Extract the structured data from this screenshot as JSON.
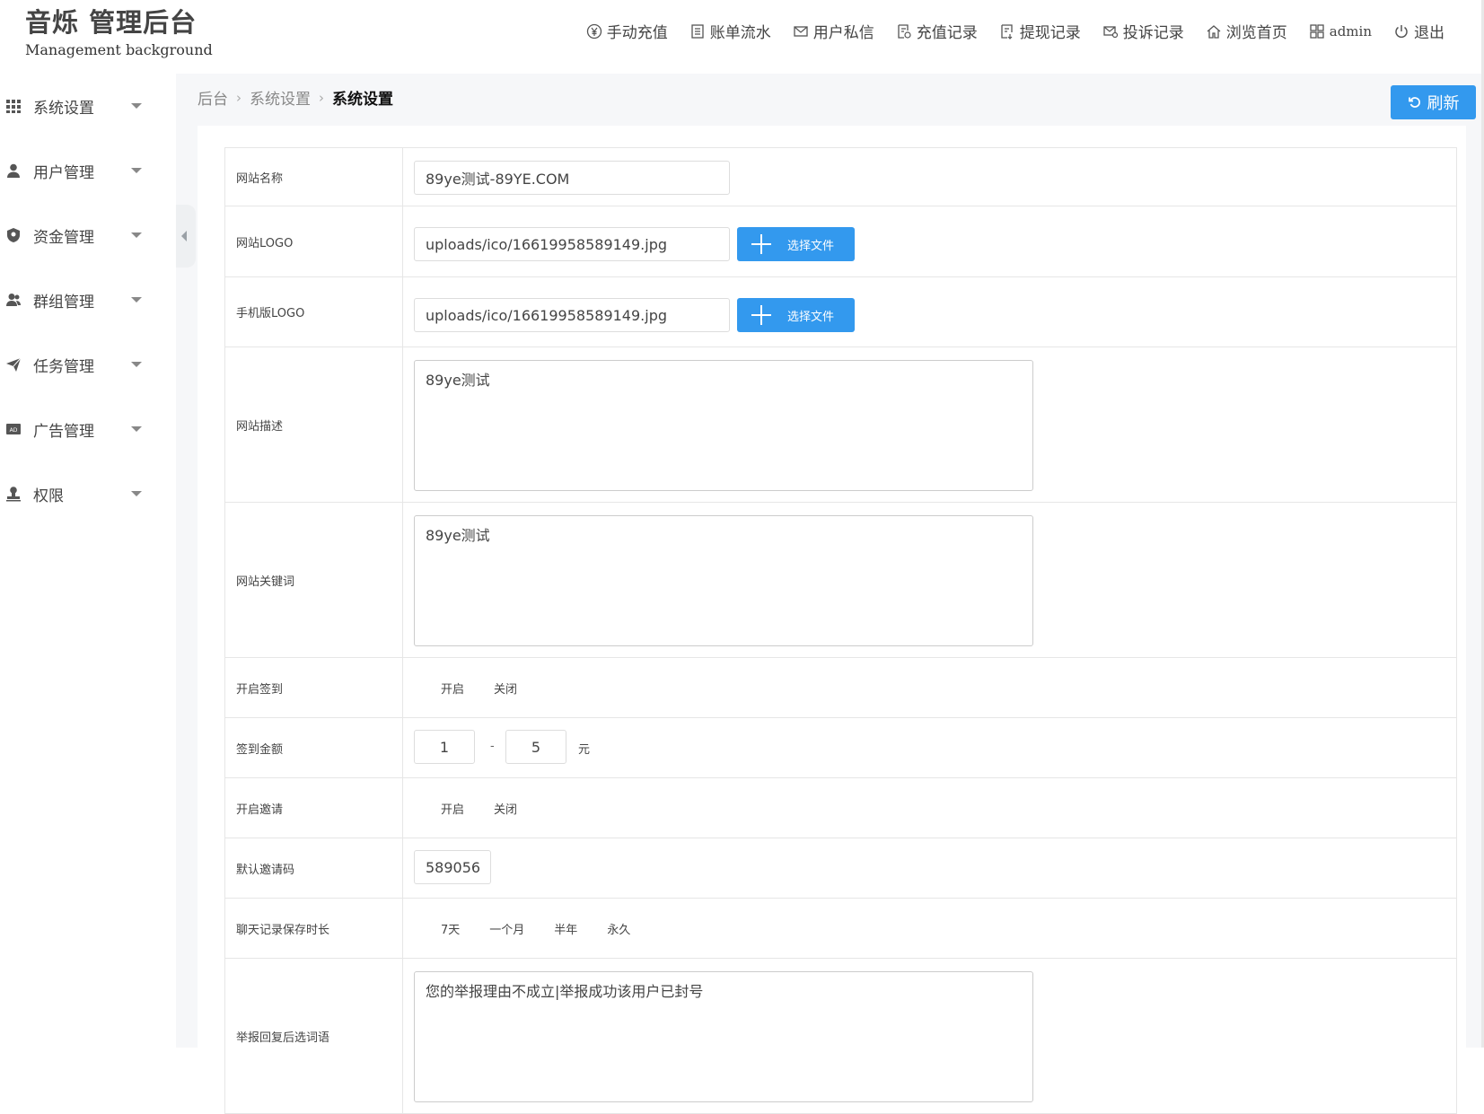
{
  "header": {
    "title": "音烁 管理后台",
    "subtitle": "Management background",
    "nav": [
      {
        "label": "手动充值",
        "icon": "yen-circle-icon"
      },
      {
        "label": "账单流水",
        "icon": "document-icon"
      },
      {
        "label": "用户私信",
        "icon": "mail-icon"
      },
      {
        "label": "充值记录",
        "icon": "recharge-record-icon"
      },
      {
        "label": "提现记录",
        "icon": "withdraw-record-icon"
      },
      {
        "label": "投诉记录",
        "icon": "complaint-mail-icon"
      },
      {
        "label": "浏览首页",
        "icon": "home-icon"
      },
      {
        "label": "admin",
        "icon": "grid-icon"
      },
      {
        "label": "退出",
        "icon": "power-icon"
      }
    ]
  },
  "sidebar": {
    "items": [
      {
        "label": "系统设置",
        "icon": "grid-icon"
      },
      {
        "label": "用户管理",
        "icon": "user-icon"
      },
      {
        "label": "资金管理",
        "icon": "shield-icon"
      },
      {
        "label": "群组管理",
        "icon": "group-icon"
      },
      {
        "label": "任务管理",
        "icon": "paper-plane-icon"
      },
      {
        "label": "广告管理",
        "icon": "ad-icon"
      },
      {
        "label": "权限",
        "icon": "stamp-icon"
      }
    ]
  },
  "breadcrumb": {
    "items": [
      "后台",
      "系统设置"
    ],
    "current": "系统设置"
  },
  "refresh": {
    "label": "刷新"
  },
  "form": {
    "site_name": {
      "label": "网站名称",
      "value": "89ye测试-89YE.COM"
    },
    "site_logo": {
      "label": "网站LOGO",
      "value": "uploads/ico/16619958589149.jpg",
      "button": "选择文件"
    },
    "mobile_logo": {
      "label": "手机版LOGO",
      "value": "uploads/ico/16619958589149.jpg",
      "button": "选择文件"
    },
    "site_desc": {
      "label": "网站描述",
      "value": "89ye测试"
    },
    "site_keywords": {
      "label": "网站关键词",
      "value": "89ye测试"
    },
    "signin_enable": {
      "label": "开启签到",
      "options": [
        "开启",
        "关闭"
      ]
    },
    "signin_amount": {
      "label": "签到金额",
      "min": "1",
      "max": "5",
      "dash": "-",
      "unit": "元"
    },
    "invite_enable": {
      "label": "开启邀请",
      "options": [
        "开启",
        "关闭"
      ]
    },
    "default_invite": {
      "label": "默认邀请码",
      "value": "589056"
    },
    "chat_retention": {
      "label": "聊天记录保存时长",
      "options": [
        "7天",
        "一个月",
        "半年",
        "永久"
      ]
    },
    "report_reply": {
      "label": "举报回复后选词语",
      "value": "您的举报理由不成立|举报成功该用户已封号"
    }
  },
  "colors": {
    "accent": "#3399ee",
    "border": "#e6e6e6",
    "main_bg": "#f6f7f9"
  }
}
